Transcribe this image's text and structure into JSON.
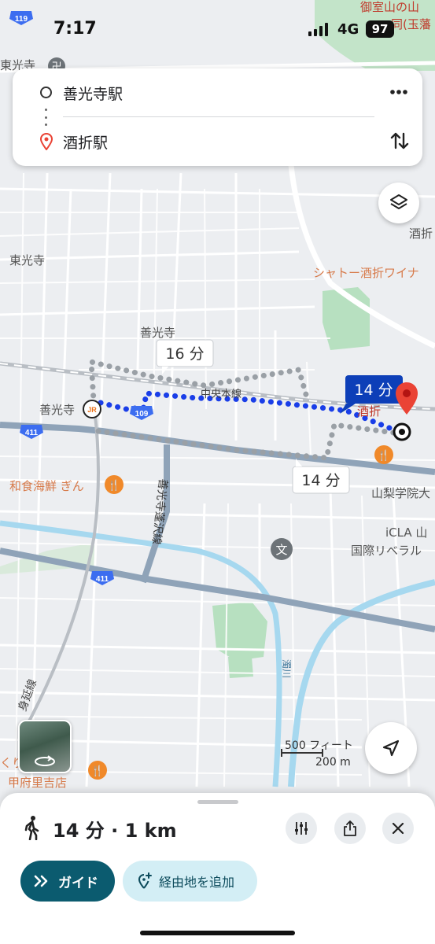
{
  "status_bar": {
    "time": "7:17",
    "network": "4G",
    "battery": "97"
  },
  "route": {
    "origin": "善光寺駅",
    "destination": "酒折駅"
  },
  "map": {
    "labels": {
      "mitsuhirayama": "御室山の山",
      "tamamoro": "同(玉藩",
      "toukouji_top": "東光寺",
      "toukouji": "東光寺",
      "sakaori_right": "酒折",
      "chateau": "シャトー酒折ワイナ",
      "zenkoji": "善光寺",
      "zenkoji_station": "善光寺",
      "chuo_line": "中央本線",
      "sakaori_station": "酒折",
      "washoku": "和食海鮮 ぎん",
      "yamanashi_gakuin": "山梨学院大",
      "icla": "iCLA 山",
      "kokusai": "国際リベラル",
      "zenkoji_street": "善光寺蓬沢線",
      "minobu_line": "身延線",
      "kofu_satoyoshi": "甲府里吉店",
      "kofu_partial": "くり",
      "river": "濁川",
      "jr": "JR"
    },
    "route_badges": {
      "selected": "14 分",
      "alt1": "16 分",
      "alt2": "14 分"
    },
    "road_shields": [
      "119",
      "109",
      "411",
      "411",
      "411"
    ],
    "colors": {
      "route": "#1a3ee8",
      "alt_route": "#9aa0a6",
      "pin": "#ea4335",
      "water": "#a6d8ef",
      "park": "#b7e0c0"
    }
  },
  "scale": {
    "feet": "500 フィート",
    "meters": "200 m"
  },
  "sheet": {
    "summary": "14 分 · 1 km",
    "guide_label": "ガイド",
    "add_waypoint_label": "経由地を追加"
  }
}
